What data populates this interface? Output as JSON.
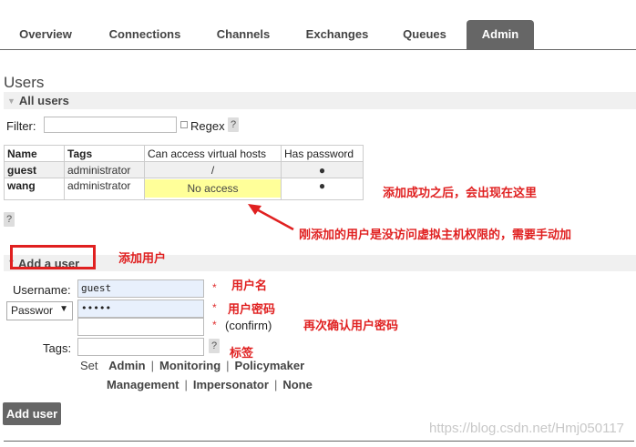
{
  "nav": {
    "tabs": [
      {
        "label": "Overview"
      },
      {
        "label": "Connections"
      },
      {
        "label": "Channels"
      },
      {
        "label": "Exchanges"
      },
      {
        "label": "Queues"
      },
      {
        "label": "Admin",
        "active": true
      }
    ]
  },
  "users_section": {
    "title": "Users",
    "all_users_label": "All users",
    "filter_label": "Filter:",
    "filter_value": "",
    "regex_label": "Regex",
    "help_label": "?",
    "table": {
      "headers": [
        "Name",
        "Tags",
        "Can access virtual hosts",
        "Has password"
      ],
      "rows": [
        {
          "name": "guest",
          "tags": "administrator",
          "vhosts": "/",
          "has_password": "●"
        },
        {
          "name": "wang",
          "tags": "administrator",
          "vhosts": "No access",
          "has_password": "●"
        }
      ]
    }
  },
  "add_user": {
    "title": "Add a user",
    "username_label": "Username:",
    "username_value": "guest",
    "password_type": "Passwor",
    "password_value": "•••••",
    "confirm_value": "",
    "required_mark": "*",
    "confirm_label": "(confirm)",
    "tags_label": "Tags:",
    "tags_value": "",
    "set_label": "Set",
    "tag_options": [
      "Admin",
      "Monitoring",
      "Policymaker",
      "Management",
      "Impersonator",
      "None"
    ],
    "separator": "|",
    "submit_label": "Add user"
  },
  "annotations": {
    "success": "添加成功之后，会出现在这里",
    "no_access": "刚添加的用户是没访问虚拟主机权限的，需要手动加",
    "add_user": "添加用户",
    "username": "用户名",
    "password": "用户密码",
    "confirm": "再次确认用户密码",
    "tags": "标签"
  },
  "colors": {
    "annotation": "#e02020",
    "tab_active_bg": "#666666",
    "no_access_bg": "#ffff99",
    "filled_input_bg": "#e8f0fc"
  },
  "watermark": "https://blog.csdn.net/Hmj050117"
}
